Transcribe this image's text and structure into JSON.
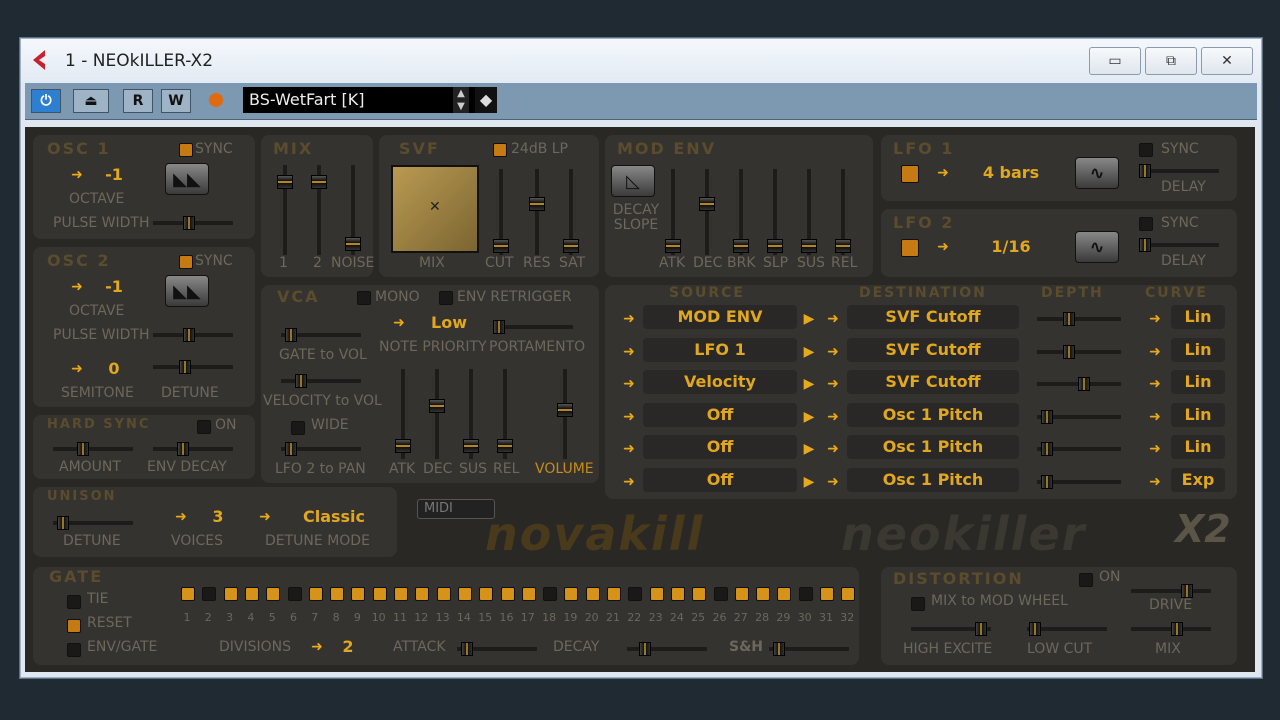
{
  "window": {
    "title": "1 - NEOkILLER-X2",
    "minimize": "▭",
    "maximize": "⧉",
    "close": "✕"
  },
  "toolbar": {
    "r": "R",
    "w": "W",
    "preset": "BS-WetFart [K]"
  },
  "osc1": {
    "title": "OSC 1",
    "sync": "SYNC",
    "octave_value": "-1",
    "octave": "OCTAVE",
    "pulse_width": "PULSE WIDTH"
  },
  "osc2": {
    "title": "OSC 2",
    "sync": "SYNC",
    "octave_value": "-1",
    "octave": "OCTAVE",
    "pulse_width": "PULSE WIDTH",
    "semitone_value": "0",
    "semitone": "SEMITONE",
    "detune": "DETUNE"
  },
  "hardsync": {
    "title": "HARD SYNC",
    "on": "ON",
    "amount": "AMOUNT",
    "env_decay": "ENV DECAY"
  },
  "unison": {
    "title": "UNISON",
    "detune": "DETUNE",
    "voices_value": "3",
    "voices": "VOICES",
    "mode_value": "Classic",
    "mode": "DETUNE MODE"
  },
  "mix": {
    "title": "MIX",
    "l1": "1",
    "l2": "2",
    "noise": "NOISE"
  },
  "svf": {
    "title": "SVF",
    "mode": "24dB LP",
    "mix": "MIX",
    "cut": "CUT",
    "res": "RES",
    "sat": "SAT"
  },
  "modenv": {
    "title": "MOD ENV",
    "decay_slope": "DECAY SLOPE",
    "atk": "ATK",
    "dec": "DEC",
    "brk": "BRK",
    "slp": "SLP",
    "sus": "SUS",
    "rel": "REL"
  },
  "lfo1": {
    "title": "LFO 1",
    "rate": "4 bars",
    "sync": "SYNC",
    "delay": "DELAY"
  },
  "lfo2": {
    "title": "LFO 2",
    "rate": "1/16",
    "sync": "SYNC",
    "delay": "DELAY"
  },
  "vca": {
    "title": "VCA",
    "mono": "MONO",
    "env_retrigger": "ENV RETRIGGER",
    "priority_value": "Low",
    "note_priority": "NOTE PRIORITY",
    "portamento": "PORTAMENTO",
    "gate_to_vol": "GATE to VOL",
    "velocity_to_vol": "VELOCITY to VOL",
    "wide": "WIDE",
    "lfo2_to_pan": "LFO 2 to PAN",
    "atk": "ATK",
    "dec": "DEC",
    "sus": "SUS",
    "rel": "REL",
    "volume": "VOLUME"
  },
  "matrix": {
    "h_source": "SOURCE",
    "h_destination": "DESTINATION",
    "h_depth": "DEPTH",
    "h_curve": "CURVE",
    "rows": [
      {
        "source": "MOD ENV",
        "dest": "SVF Cutoff",
        "curve": "Lin",
        "depth": 0.35
      },
      {
        "source": "LFO 1",
        "dest": "SVF Cutoff",
        "curve": "Lin",
        "depth": 0.35
      },
      {
        "source": "Velocity",
        "dest": "SVF Cutoff",
        "curve": "Lin",
        "depth": 0.55
      },
      {
        "source": "Off",
        "dest": "Osc 1 Pitch",
        "curve": "Lin",
        "depth": 0.05
      },
      {
        "source": "Off",
        "dest": "Osc 1 Pitch",
        "curve": "Lin",
        "depth": 0.05
      },
      {
        "source": "Off",
        "dest": "Osc 1 Pitch",
        "curve": "Exp",
        "depth": 0.05
      }
    ]
  },
  "midi": "MIDI",
  "logo": {
    "brand": "novakill",
    "product": "neokiller",
    "x2": "X2"
  },
  "gate": {
    "title": "GATE",
    "tie": "TIE",
    "reset": "RESET",
    "env_gate": "ENV/GATE",
    "divisions": "DIVISIONS",
    "divisions_value": "2",
    "attack": "ATTACK",
    "decay": "DECAY",
    "sh": "S&H",
    "steps": [
      1,
      0,
      1,
      1,
      1,
      0,
      1,
      1,
      1,
      1,
      1,
      1,
      1,
      1,
      1,
      1,
      1,
      0,
      1,
      1,
      1,
      0,
      1,
      1,
      1,
      0,
      1,
      1,
      1,
      0,
      1,
      1
    ],
    "step_numbers": [
      "1",
      "2",
      "3",
      "4",
      "5",
      "6",
      "7",
      "8",
      "9",
      "10",
      "11",
      "12",
      "13",
      "14",
      "15",
      "16",
      "17",
      "18",
      "19",
      "20",
      "21",
      "22",
      "23",
      "24",
      "25",
      "26",
      "27",
      "28",
      "29",
      "30",
      "31",
      "32"
    ]
  },
  "distortion": {
    "title": "DISTORTION",
    "on": "ON",
    "mix_to_mod": "MIX to MOD WHEEL",
    "drive": "DRIVE",
    "high_excite": "HIGH EXCITE",
    "low_cut": "LOW CUT",
    "mix": "MIX"
  },
  "colors": {
    "accent": "#e0a71f",
    "panel": "#353330",
    "bg": "#2a2825"
  }
}
